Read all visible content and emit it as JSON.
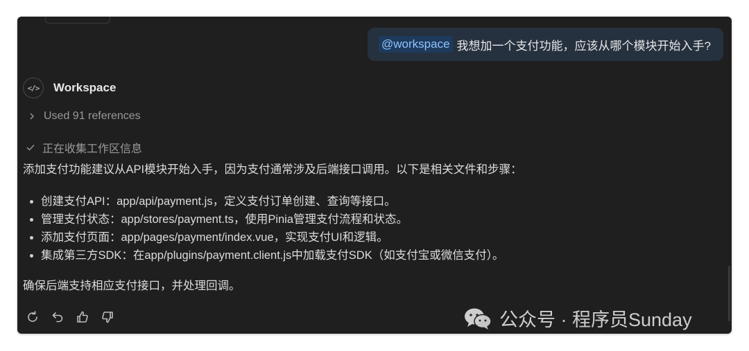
{
  "user_message": {
    "mention": "@workspace",
    "text": "我想加一个支付功能，应该从哪个模块开始入手?"
  },
  "agent": {
    "icon": "code-icon",
    "name": "Workspace"
  },
  "references": {
    "label": "Used 91 references"
  },
  "status": {
    "label": "正在收集工作区信息"
  },
  "answer": {
    "intro": "添加支付功能建议从API模块开始入手，因为支付通常涉及后端接口调用。以下是相关文件和步骤：",
    "items": [
      "创建支付API：app/api/payment.js，定义支付订单创建、查询等接口。",
      "管理支付状态：app/stores/payment.ts，使用Pinia管理支付流程和状态。",
      "添加支付页面：app/pages/payment/index.vue，实现支付UI和逻辑。",
      "集成第三方SDK：在app/plugins/payment.client.js中加载支付SDK（如支付宝或微信支付）。"
    ],
    "outro": "确保后端支持相应支付接口，并处理回调。"
  },
  "actions": [
    {
      "icon": "refresh-icon"
    },
    {
      "icon": "undo-icon"
    },
    {
      "icon": "thumbs-up-icon"
    },
    {
      "icon": "thumbs-down-icon"
    }
  ],
  "watermark": {
    "text": "公众号 · 程序员Sunday"
  },
  "colors": {
    "panel_bg": "#1f1f1f",
    "user_bubble_bg": "#26313f",
    "mention_text": "#8ec5ff"
  }
}
